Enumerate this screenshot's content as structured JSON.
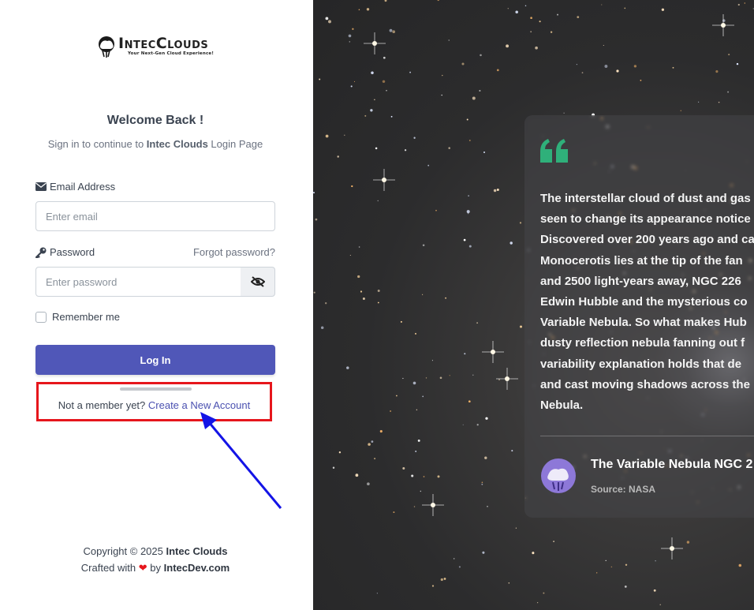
{
  "brand": {
    "name": "IntecClouds",
    "tagline": "Your Next-Gen Cloud Experience!"
  },
  "header": {
    "welcome": "Welcome Back !",
    "subtitle_prefix": "Sign in to continue to ",
    "subtitle_brand": "Intec Clouds",
    "subtitle_suffix": " Login Page"
  },
  "form": {
    "email_label": "Email Address",
    "email_placeholder": "Enter email",
    "password_label": "Password",
    "forgot_link": "Forgot password?",
    "password_placeholder": "Enter password",
    "remember_label": "Remember me",
    "login_button": "Log In",
    "signup_prompt": "Not a member yet? ",
    "signup_link": "Create a New Account"
  },
  "footer": {
    "copyright_prefix": "Copyright © 2025 ",
    "copyright_brand": "Intec Clouds",
    "crafted_prefix": "Crafted with ",
    "crafted_by": " by ",
    "crafted_brand": "IntecDev.com"
  },
  "testimonial": {
    "lines": [
      "The interstellar cloud of dust and gas",
      "seen to change its appearance notice",
      "Discovered over 200 years ago and ca",
      "Monocerotis lies at the tip of the fan",
      "and 2500 light-years away, NGC 226",
      "Edwin Hubble and the mysterious co",
      "Variable Nebula. So what makes Hub",
      "dusty reflection nebula fanning out f",
      "variability explanation holds that de",
      "and cast moving shadows across the",
      "Nebula."
    ],
    "title": "The Variable Nebula NGC 2",
    "source": "Source: NASA"
  },
  "colors": {
    "primary": "#5057b8",
    "link": "#4a50b0",
    "highlight": "#e6161c",
    "annotation_arrow": "#1414e6",
    "quote_accent": "#2fb07a"
  },
  "icons": {
    "email": "envelope-icon",
    "password": "key-icon",
    "toggle": "eye-slash-icon",
    "heart": "heart-icon",
    "quote": "quote-icon"
  }
}
